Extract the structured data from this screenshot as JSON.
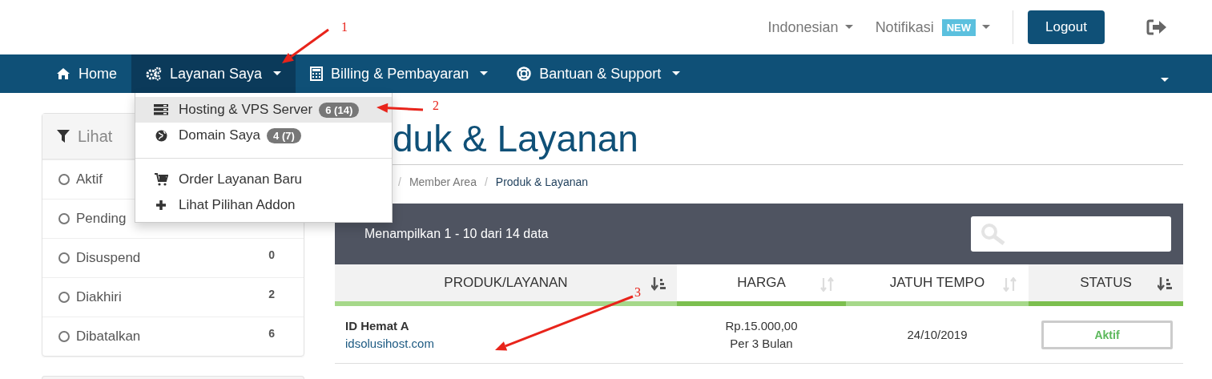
{
  "header": {
    "language": "Indonesian",
    "notifications": {
      "label": "Notifikasi",
      "badge": "NEW"
    },
    "logout": "Logout"
  },
  "nav": {
    "items": [
      {
        "label": "Home",
        "selected": false,
        "dropdown": false
      },
      {
        "label": "Layanan Saya",
        "selected": true,
        "dropdown": true
      },
      {
        "label": "Billing & Pembayaran",
        "selected": false,
        "dropdown": true
      },
      {
        "label": "Bantuan & Support",
        "selected": false,
        "dropdown": true
      }
    ]
  },
  "dropdown": {
    "items": [
      {
        "label": "Hosting & VPS Server",
        "badge": "6 (14)",
        "selected": true
      },
      {
        "label": "Domain Saya",
        "badge": "4 (7)",
        "selected": false
      },
      {
        "kind": "divider"
      },
      {
        "label": "Order Layanan Baru",
        "selected": false
      },
      {
        "label": "Lihat Pilihan Addon",
        "selected": false
      }
    ]
  },
  "sidebar": {
    "title": "Lihat",
    "items": [
      {
        "label": "Aktif",
        "selected": false
      },
      {
        "label": "Pending",
        "selected": false
      },
      {
        "label": "Disuspend",
        "count": "0",
        "selected": false
      },
      {
        "label": "Diakhiri",
        "count": "2",
        "selected": false
      },
      {
        "label": "Dibatalkan",
        "count": "6",
        "selected": false
      }
    ]
  },
  "page": {
    "title": "duk & Layanan",
    "breadcrumb": [
      {
        "kind": "separator",
        "label": "/"
      },
      {
        "kind": "link",
        "label": "Member Area"
      },
      {
        "kind": "separator",
        "label": "/"
      },
      {
        "kind": "current",
        "label": "Produk & Layanan"
      }
    ]
  },
  "table": {
    "info": "Menampilkan 1 - 10 dari 14 data",
    "columns": [
      {
        "label": "PRODUK/LAYANAN",
        "sorted": true
      },
      {
        "label": "HARGA",
        "sorted": false
      },
      {
        "label": "JATUH TEMPO",
        "sorted": false
      },
      {
        "label": "STATUS",
        "sorted": true
      }
    ],
    "rows": [
      {
        "product": "ID Hemat A",
        "domain": "idsolusihost.com",
        "price": "Rp.15.000,00",
        "cycle": "Per 3 Bulan",
        "due": "24/10/2019",
        "status": "Aktif"
      }
    ]
  },
  "annotations": [
    {
      "label": "1"
    },
    {
      "label": "2"
    },
    {
      "label": "3"
    }
  ]
}
